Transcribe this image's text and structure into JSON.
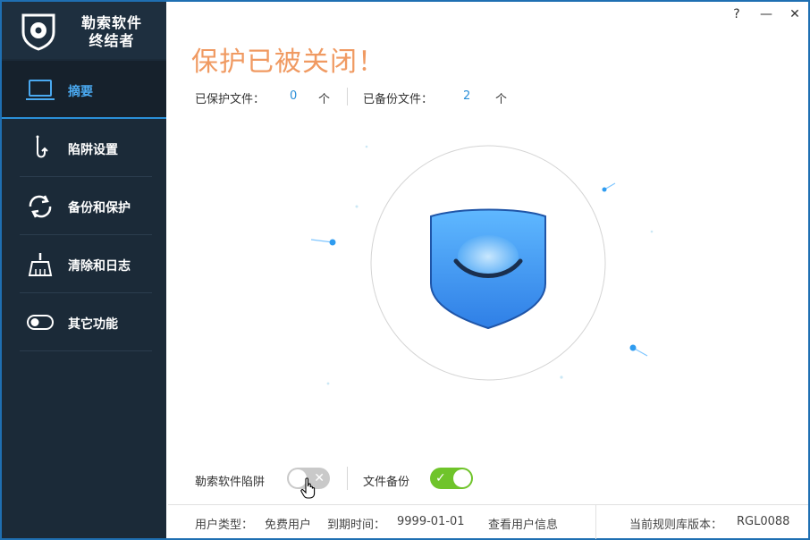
{
  "app": {
    "title_line1": "勒索软件",
    "title_line2": "终结者"
  },
  "titlebar": {
    "help": "?",
    "minimize": "—",
    "close": "✕"
  },
  "sidebar": {
    "items": [
      {
        "label": "摘要",
        "icon": "laptop-icon",
        "active": true
      },
      {
        "label": "陷阱设置",
        "icon": "hook-icon",
        "active": false
      },
      {
        "label": "备份和保护",
        "icon": "sync-icon",
        "active": false
      },
      {
        "label": "清除和日志",
        "icon": "broom-icon",
        "active": false
      },
      {
        "label": "其它功能",
        "icon": "toggle-icon",
        "active": false
      }
    ]
  },
  "main": {
    "status_title": "保护已被关闭！",
    "stats": {
      "protected_label": "已保护文件：",
      "protected_count": "0",
      "protected_unit": "个",
      "backup_label": "已备份文件：",
      "backup_count": "2",
      "backup_unit": "个"
    },
    "toggles": {
      "trap_label": "勒索软件陷阱",
      "trap_on": false,
      "trap_glyph": "✕",
      "backup_label": "文件备份",
      "backup_on": true,
      "backup_glyph": "✓"
    }
  },
  "footer": {
    "user_type_label": "用户类型：",
    "user_type": "免费用户",
    "expire_label": "到期时间：",
    "expire_date": "9999-01-01",
    "view_user_info": "查看用户信息",
    "rule_version_label": "当前规则库版本：",
    "rule_version": "RGL0088"
  },
  "colors": {
    "sidebar_bg": "#1b2a38",
    "accent": "#2b8fd8",
    "warning": "#f09a62",
    "toggle_on": "#6fc42a",
    "toggle_off": "#c9c9c9"
  }
}
